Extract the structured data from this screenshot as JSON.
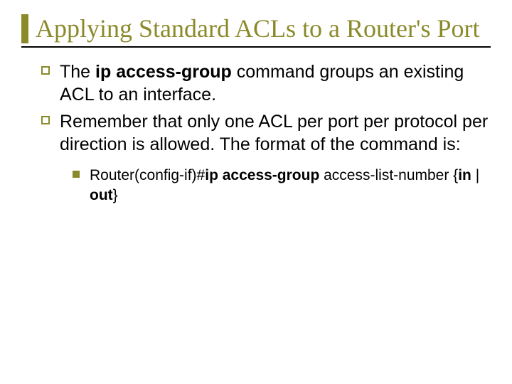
{
  "title": "Applying Standard ACLs to a Router's Port",
  "bullets": [
    {
      "pre": "The ",
      "bold": "ip access-group",
      "post": " command groups an existing ACL to an interface."
    },
    {
      "full": "Remember that only one ACL per port per protocol per direction is allowed. The format of the command is:"
    }
  ],
  "sub": {
    "seg1": "Router(config-if)#",
    "seg2_bold": "ip access-group",
    "seg3": " access-list-number {",
    "seg4_bold": "in",
    "seg5": " | ",
    "seg6_bold": "out",
    "seg7": "}"
  }
}
